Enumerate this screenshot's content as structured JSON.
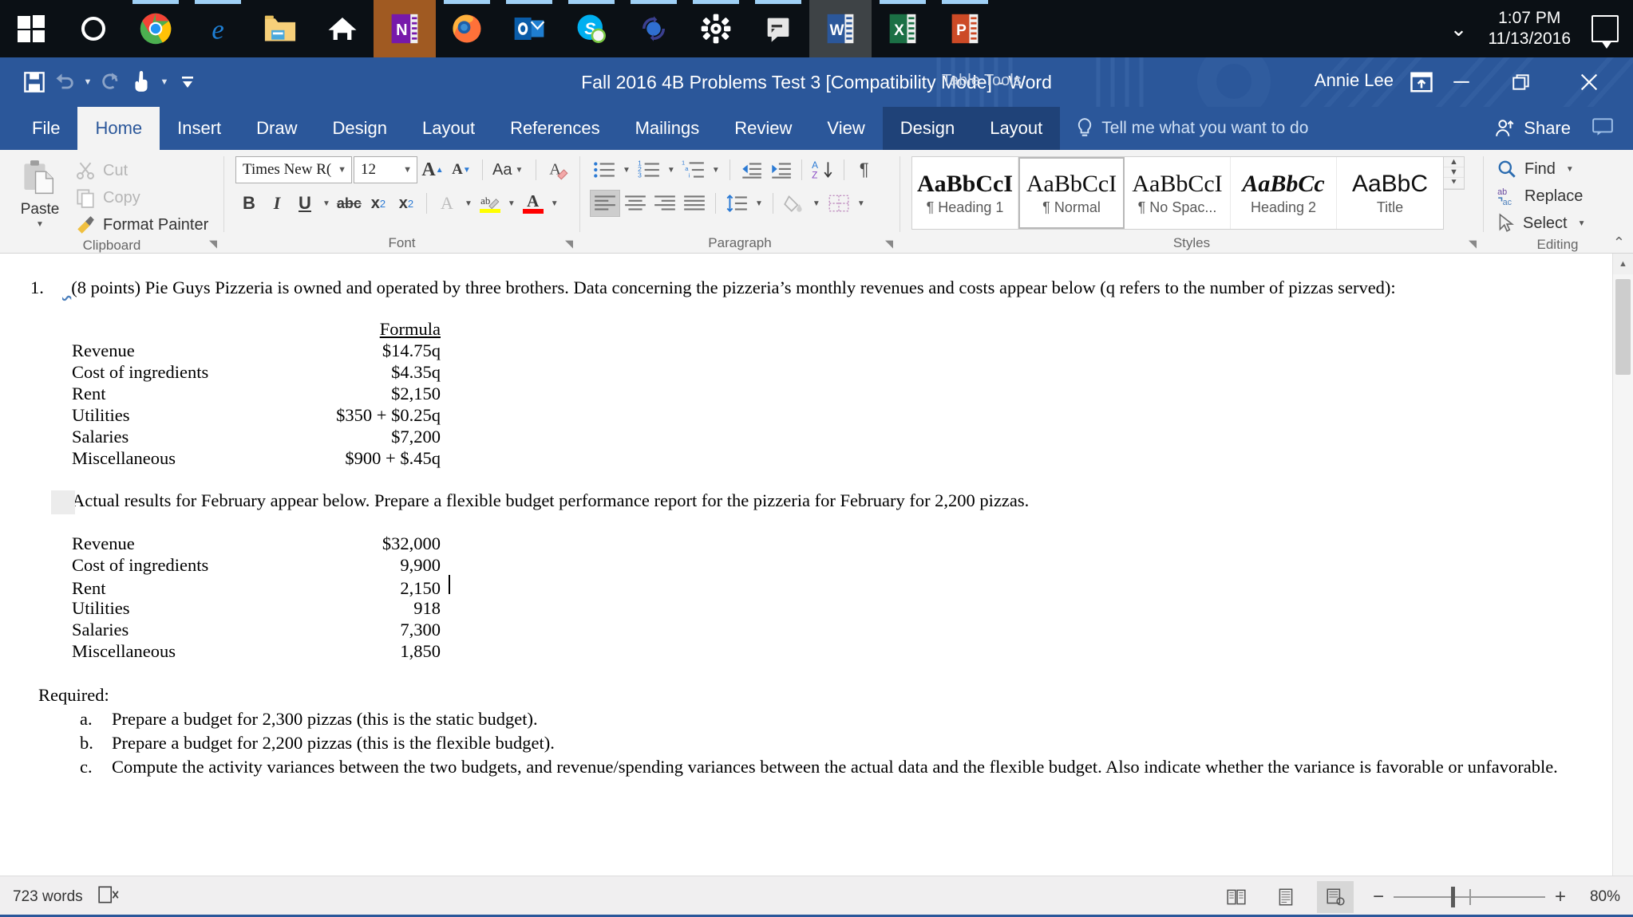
{
  "taskbar": {
    "items": [
      {
        "name": "start-button",
        "icon": "windows-logo-icon",
        "label": "Start"
      },
      {
        "name": "cortana-button",
        "icon": "cortana-circle-icon",
        "label": "Cortana"
      },
      {
        "name": "taskbar-chrome",
        "icon": "chrome-icon",
        "label": "Google Chrome"
      },
      {
        "name": "taskbar-edge",
        "icon": "edge-icon",
        "label": "Microsoft Edge"
      },
      {
        "name": "taskbar-file-explorer",
        "icon": "folder-icon",
        "label": "File Explorer"
      },
      {
        "name": "taskbar-home",
        "icon": "house-icon",
        "label": "Home"
      },
      {
        "name": "taskbar-onenote",
        "icon": "onenote-icon",
        "label": "OneNote"
      },
      {
        "name": "taskbar-firefox",
        "icon": "firefox-icon",
        "label": "Mozilla Firefox"
      },
      {
        "name": "taskbar-outlook",
        "icon": "outlook-icon",
        "label": "Outlook"
      },
      {
        "name": "taskbar-skype",
        "icon": "skype-icon",
        "label": "Skype"
      },
      {
        "name": "taskbar-sync",
        "icon": "sync-globe-icon",
        "label": "Sync"
      },
      {
        "name": "taskbar-settings",
        "icon": "gear-icon",
        "label": "Settings"
      },
      {
        "name": "taskbar-messaging",
        "icon": "chat-bubble-icon",
        "label": "Messaging"
      },
      {
        "name": "taskbar-word",
        "icon": "word-icon",
        "label": "Microsoft Word"
      },
      {
        "name": "taskbar-excel",
        "icon": "excel-icon",
        "label": "Microsoft Excel"
      },
      {
        "name": "taskbar-powerpoint",
        "icon": "powerpoint-icon",
        "label": "Microsoft PowerPoint"
      }
    ],
    "time": "1:07 PM",
    "date": "11/13/2016",
    "show_hidden_icons": "show-hidden-icons-chevron",
    "action_center": "action-center-icon"
  },
  "window": {
    "title": "Fall 2016 4B Problems Test 3 [Compatibility Mode]  -  Word",
    "contextual_tools": "Table Tools",
    "user": "Annie Lee",
    "ribbon_display_options": "ribbon-display-options-icon",
    "minimize": "minimize-icon",
    "restore": "restore-icon",
    "close": "close-icon"
  },
  "qat": [
    {
      "name": "save-button",
      "icon": "save-floppy-icon",
      "label": "Save"
    },
    {
      "name": "undo-button",
      "icon": "undo-arrow-icon",
      "label": "Undo"
    },
    {
      "name": "redo-button",
      "icon": "redo-arrow-icon",
      "label": "Repeat"
    },
    {
      "name": "touch-mouse-mode-button",
      "icon": "touch-hand-icon",
      "label": "Touch/Mouse Mode"
    },
    {
      "name": "customize-qat-button",
      "icon": "chevron-down-bar-icon",
      "label": "Customize Quick Access Toolbar"
    }
  ],
  "ribbon": {
    "tabs": [
      {
        "label": "File",
        "selected": false,
        "contextual": false
      },
      {
        "label": "Home",
        "selected": true,
        "contextual": false
      },
      {
        "label": "Insert",
        "selected": false,
        "contextual": false
      },
      {
        "label": "Draw",
        "selected": false,
        "contextual": false
      },
      {
        "label": "Design",
        "selected": false,
        "contextual": false
      },
      {
        "label": "Layout",
        "selected": false,
        "contextual": false
      },
      {
        "label": "References",
        "selected": false,
        "contextual": false
      },
      {
        "label": "Mailings",
        "selected": false,
        "contextual": false
      },
      {
        "label": "Review",
        "selected": false,
        "contextual": false
      },
      {
        "label": "View",
        "selected": false,
        "contextual": false
      },
      {
        "label": "Design",
        "selected": false,
        "contextual": true
      },
      {
        "label": "Layout",
        "selected": false,
        "contextual": true
      }
    ],
    "tell_me": "Tell me what you want to do",
    "share": "Share",
    "comments_icon": "comment-icon",
    "collapse_ribbon": "collapse-ribbon-caret",
    "clipboard": {
      "group_label": "Clipboard",
      "paste": "Paste",
      "cut": "Cut",
      "copy": "Copy",
      "format_painter": "Format Painter"
    },
    "font": {
      "group_label": "Font",
      "font_family": "Times New R(",
      "font_family_full": "Times New Roman",
      "font_size": "12",
      "grow_font": "A",
      "shrink_font": "A",
      "change_case": "Aa",
      "clear_formatting": "clear-formatting-icon",
      "bold": "B",
      "italic": "I",
      "underline": "U",
      "strikethrough": "abc",
      "subscript": "x",
      "superscript": "x",
      "text_effects": "A",
      "highlight": "highlight-icon",
      "font_color": "A",
      "highlight_color": "#ffff00",
      "font_color_value": "#ff0000"
    },
    "paragraph": {
      "group_label": "Paragraph",
      "bullets": "bullets-icon",
      "numbering": "numbering-icon",
      "multilevel_list": "multilevel-list-icon",
      "decrease_indent": "decrease-indent-icon",
      "increase_indent": "increase-indent-icon",
      "sort": "sort-az-icon",
      "show_marks": "pilcrow-icon",
      "align_left": "align-left-icon",
      "align_center": "align-center-icon",
      "align_right": "align-right-icon",
      "justify": "justify-icon",
      "line_spacing": "line-spacing-icon",
      "shading": "shading-bucket-icon",
      "borders": "borders-icon"
    },
    "styles": {
      "group_label": "Styles",
      "items": [
        {
          "preview": "AaBbCcI",
          "name": "¶ Heading 1",
          "selected": false,
          "style": "h1"
        },
        {
          "preview": "AaBbCcI",
          "name": "¶ Normal",
          "selected": true,
          "style": "normal"
        },
        {
          "preview": "AaBbCcI",
          "name": "¶ No Spac...",
          "selected": false,
          "style": "nospace"
        },
        {
          "preview": "AaBbCc",
          "name": "Heading 2",
          "selected": false,
          "style": "h2"
        },
        {
          "preview": "AaBbC",
          "name": "Title",
          "selected": false,
          "style": "title"
        }
      ]
    },
    "editing": {
      "group_label": "Editing",
      "find": "Find",
      "replace": "Replace",
      "select": "Select"
    }
  },
  "document": {
    "question_number": "1.",
    "question_text": "(8 points) Pie Guys Pizzeria is owned and operated by three brothers. Data concerning the pizzeria’s monthly revenues and costs appear below (q refers to the number of pizzas served):",
    "formula_table": {
      "header_col2": "Formula",
      "rows": [
        {
          "label": "Revenue",
          "value": "$14.75q"
        },
        {
          "label": "Cost of ingredients",
          "value": "$4.35q"
        },
        {
          "label": "Rent",
          "value": "$2,150"
        },
        {
          "label": "Utilities",
          "value": "$350 + $0.25q"
        },
        {
          "label": "Salaries",
          "value": "$7,200"
        },
        {
          "label": "Miscellaneous",
          "value": "$900 + $.45q"
        }
      ]
    },
    "actual_intro": "Actual results for February appear below. Prepare a flexible budget performance report for the pizzeria for February for 2,200 pizzas.",
    "actual_table": {
      "rows": [
        {
          "label": "Revenue",
          "value": "$32,000"
        },
        {
          "label": "Cost of ingredients",
          "value": "9,900"
        },
        {
          "label": "Rent",
          "value": "2,150"
        },
        {
          "label": "Utilities",
          "value": "918"
        },
        {
          "label": "Salaries",
          "value": "7,300"
        },
        {
          "label": "Miscellaneous",
          "value": "1,850"
        }
      ]
    },
    "required_label": "Required:",
    "required_items": [
      {
        "letter": "a.",
        "text": "Prepare a budget for 2,300 pizzas (this is the static budget)."
      },
      {
        "letter": "b.",
        "text": "Prepare a budget for 2,200 pizzas (this is the flexible budget)."
      },
      {
        "letter": "c.",
        "text": "Compute the activity variances between the two budgets, and revenue/spending variances between the actual data and the flexible budget.  Also indicate whether the variance is favorable or unfavorable."
      }
    ]
  },
  "statusbar": {
    "word_count": "723 words",
    "proofing_icon": "proofing-errors-icon",
    "views": [
      {
        "name": "read-mode-view",
        "icon": "read-mode-icon",
        "selected": false
      },
      {
        "name": "print-layout-view",
        "icon": "print-layout-icon",
        "selected": false
      },
      {
        "name": "web-layout-view",
        "icon": "web-layout-icon",
        "selected": true
      }
    ],
    "zoom_out": "−",
    "zoom_in": "+",
    "zoom_level": "80%"
  },
  "colors": {
    "word_blue": "#2b579a",
    "contextual_tab": "#1f4278",
    "ribbon_bg": "#f3f3f3",
    "taskbar": "#0b1015",
    "highlight_yellow": "#ffff00",
    "font_red": "#ff0000",
    "onenote_purple": "#7719aa",
    "spell_squiggle": "#4a7ebb"
  }
}
